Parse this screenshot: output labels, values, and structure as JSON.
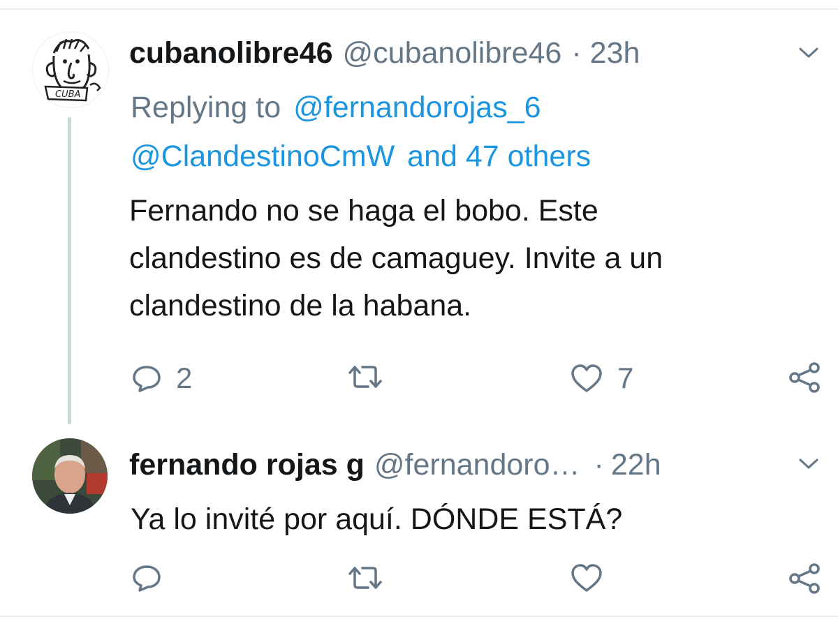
{
  "tweets": [
    {
      "display_name": "cubanolibre46",
      "handle": "@cubanolibre46",
      "separator": "·",
      "time": "23h",
      "replying_prefix": "Replying to",
      "replying_user": "@fernandorojas_6",
      "replying_user2": "@ClandestinoCmW",
      "replying_others": "and 47 others",
      "text_lines": [
        "Fernando no se haga el bobo. Este",
        "clandestino es de camaguey. Invite a un",
        "clandestino de la habana."
      ],
      "reply_count": "2",
      "retweet_count": "",
      "like_count": "7",
      "avatar_caption": "CUBA"
    },
    {
      "display_name": "fernando rojas g",
      "handle": "@fernandoro…",
      "separator": "·",
      "time": "22h",
      "text": "Ya lo invité por aquí. DÓNDE ESTÁ?",
      "reply_count": "",
      "like_count": ""
    }
  ],
  "icons": {
    "reply": "reply-icon",
    "retweet": "retweet-icon",
    "like": "heart-icon",
    "share": "share-icon",
    "menu": "chevron-down-icon"
  },
  "colors": {
    "link": "#1b95e0",
    "muted": "#657786",
    "text": "#14171a",
    "divider": "#e6ecf0"
  }
}
